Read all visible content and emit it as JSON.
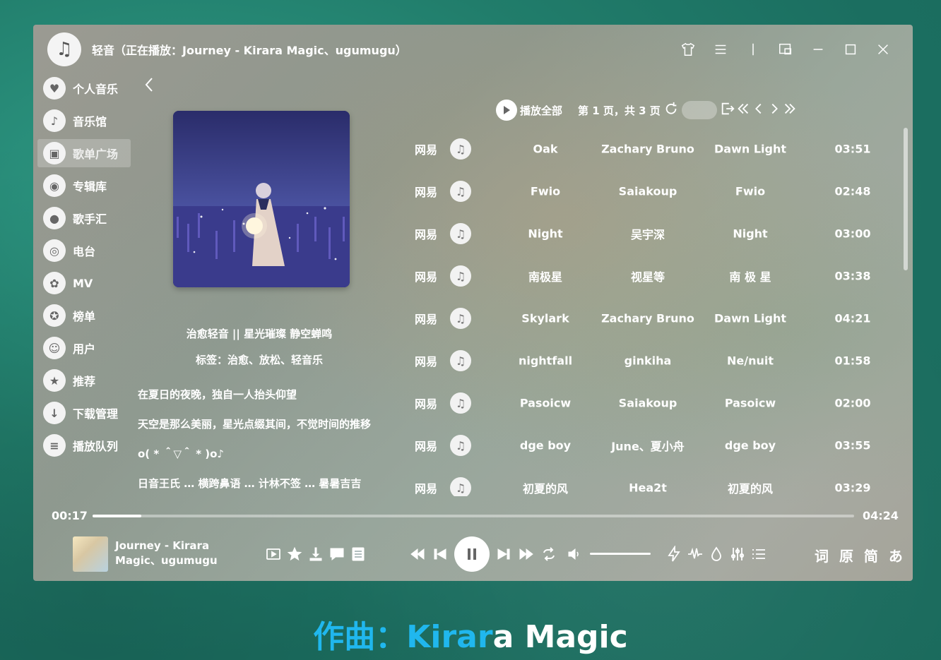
{
  "window": {
    "title": "轻音（正在播放：Journey - Kirara Magic、ugumugu）",
    "icons": [
      "music-note-icon",
      "tshirt-icon",
      "menu-icon",
      "divider",
      "miniplayer-icon",
      "minimize-icon",
      "maximize-icon",
      "close-icon"
    ]
  },
  "sidebar": {
    "items": [
      {
        "label": "个人音乐",
        "icon": "heart-icon"
      },
      {
        "label": "音乐馆",
        "icon": "music-note-icon"
      },
      {
        "label": "歌单广场",
        "icon": "playlist-icon",
        "active": true
      },
      {
        "label": "专辑库",
        "icon": "album-icon"
      },
      {
        "label": "歌手汇",
        "icon": "singer-icon"
      },
      {
        "label": "电台",
        "icon": "radio-icon"
      },
      {
        "label": "MV",
        "icon": "film-reel-icon"
      },
      {
        "label": "榜单",
        "icon": "medal-icon"
      },
      {
        "label": "用户",
        "icon": "user-icon"
      },
      {
        "label": "推荐",
        "icon": "star-icon"
      },
      {
        "label": "下载管理",
        "icon": "download-icon"
      },
      {
        "label": "播放队列",
        "icon": "queue-icon"
      }
    ]
  },
  "playlist": {
    "title": "治愈轻音 || 星光璀璨 静空蝉鸣",
    "tags": "标签：治愈、放松、轻音乐",
    "description": [
      "在夏日的夜晚，独自一人抬头仰望",
      "天空是那么美丽，星光点缀其间，不觉时间的推移",
      "o( * ＾▽＾ * )o♪",
      "日音王氏 … 横跨鼻语 … 计林不签 … 暑暑吉吉"
    ]
  },
  "toolbar": {
    "play_all": "播放全部",
    "page_info": "第 1 页，共 3 页"
  },
  "songs": [
    {
      "source": "网易",
      "name": "Oak",
      "artist": "Zachary Bruno",
      "album": "Dawn Light",
      "duration": "03:51"
    },
    {
      "source": "网易",
      "name": "Fwio",
      "artist": "Saiakoup",
      "album": "Fwio",
      "duration": "02:48"
    },
    {
      "source": "网易",
      "name": "Night",
      "artist": "吴宇深",
      "album": "Night",
      "duration": "03:00"
    },
    {
      "source": "网易",
      "name": "南极星",
      "artist": "视星等",
      "album": "南 极 星",
      "duration": "03:38"
    },
    {
      "source": "网易",
      "name": "Skylark",
      "artist": "Zachary Bruno",
      "album": "Dawn Light",
      "duration": "04:21"
    },
    {
      "source": "网易",
      "name": "nightfall",
      "artist": "ginkiha",
      "album": "Ne/nuit",
      "duration": "01:58"
    },
    {
      "source": "网易",
      "name": "Pasoicw",
      "artist": "Saiakoup",
      "album": "Pasoicw",
      "duration": "02:00"
    },
    {
      "source": "网易",
      "name": "dge boy",
      "artist": "June、夏小舟",
      "album": "dge boy",
      "duration": "03:55"
    },
    {
      "source": "网易",
      "name": "初夏的风",
      "artist": "Hea2t",
      "album": "初夏的风",
      "duration": "03:29"
    }
  ],
  "player": {
    "current_time": "00:17",
    "total_time": "04:24",
    "progress": 0.064,
    "now_playing": "Journey - Kirara Magic、ugumugu",
    "volume": 1.0,
    "lyric_tools": "词 原 简 あ"
  },
  "caption": {
    "prefix": "作曲：Kirar",
    "suffix": "a Magic"
  }
}
